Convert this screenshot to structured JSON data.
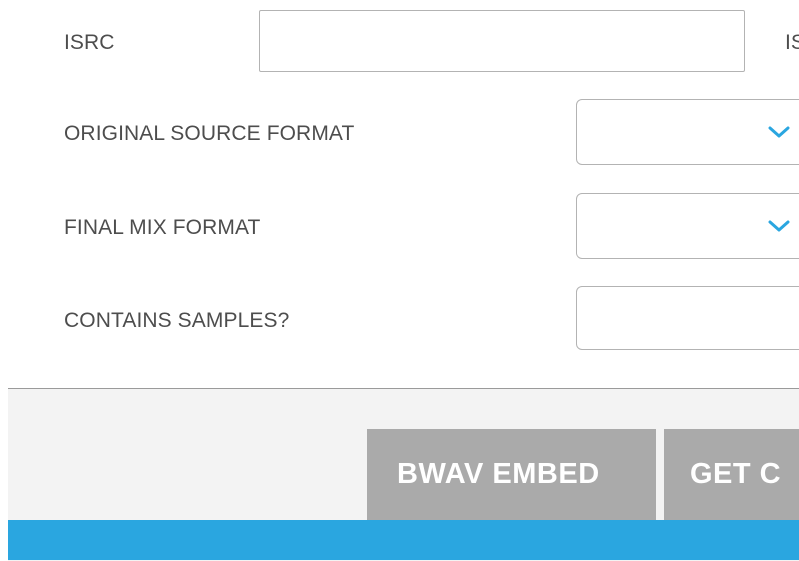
{
  "form": {
    "isrc": {
      "label": "ISRC",
      "value": ""
    },
    "next_column_label": "IS",
    "original_source_format": {
      "label": "ORIGINAL SOURCE FORMAT",
      "value": ""
    },
    "final_mix_format": {
      "label": "FINAL MIX FORMAT",
      "value": ""
    },
    "contains_samples": {
      "label": "CONTAINS SAMPLES?",
      "value": ""
    }
  },
  "footer": {
    "bwav_embed_label": "BWAV EMBED",
    "get_label": "GET C"
  },
  "colors": {
    "accent_blue": "#2aa6e0",
    "chevron_blue": "#2aa6e0",
    "button_gray": "#aaaaaa",
    "footer_bg": "#f3f3f3"
  },
  "icons": {
    "dropdown": "chevron-down-icon"
  }
}
